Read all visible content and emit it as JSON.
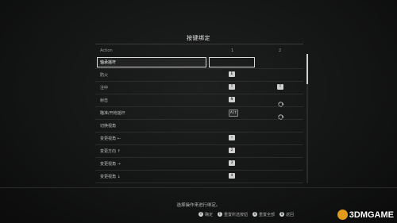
{
  "title": "按键绑定",
  "header": {
    "action": "Action",
    "col1": "1",
    "col2": "2"
  },
  "rows": [
    {
      "label": "轴承摇杆",
      "key1": "",
      "key2": "",
      "selected": true
    },
    {
      "label": "防火",
      "key1": "E",
      "key2": ""
    },
    {
      "label": "注中",
      "key1": "T",
      "key2": "T"
    },
    {
      "label": "射击",
      "key1": "N",
      "key2": "mouse"
    },
    {
      "label": "瞄准/开枪摇杆",
      "key1": "Alt",
      "key2": "mouse"
    },
    {
      "label": "切换视角",
      "key1": "",
      "key2": ""
    },
    {
      "label": "变更视角 ←",
      "key1": "↑",
      "key2": ""
    },
    {
      "label": "变更方向 ↑",
      "key1": "2",
      "key2": ""
    },
    {
      "label": "变更视角 →",
      "key1": "3",
      "key2": ""
    },
    {
      "label": "变更视角 ↓",
      "key1": "4",
      "key2": ""
    }
  ],
  "hint": "选择操作来进行绑定。",
  "controls": [
    {
      "btn": "Y",
      "label": "确定"
    },
    {
      "btn": "F",
      "label": "重置所选按钮"
    },
    {
      "btn": "X",
      "label": "重置全部"
    },
    {
      "btn": "B",
      "label": "返回"
    }
  ],
  "watermark": "3DMGAME",
  "colors": {
    "background": "#141515",
    "text": "#cfcfcf",
    "selection_border": "#d8d8d8",
    "watermark_logo": "#e39a1b"
  }
}
